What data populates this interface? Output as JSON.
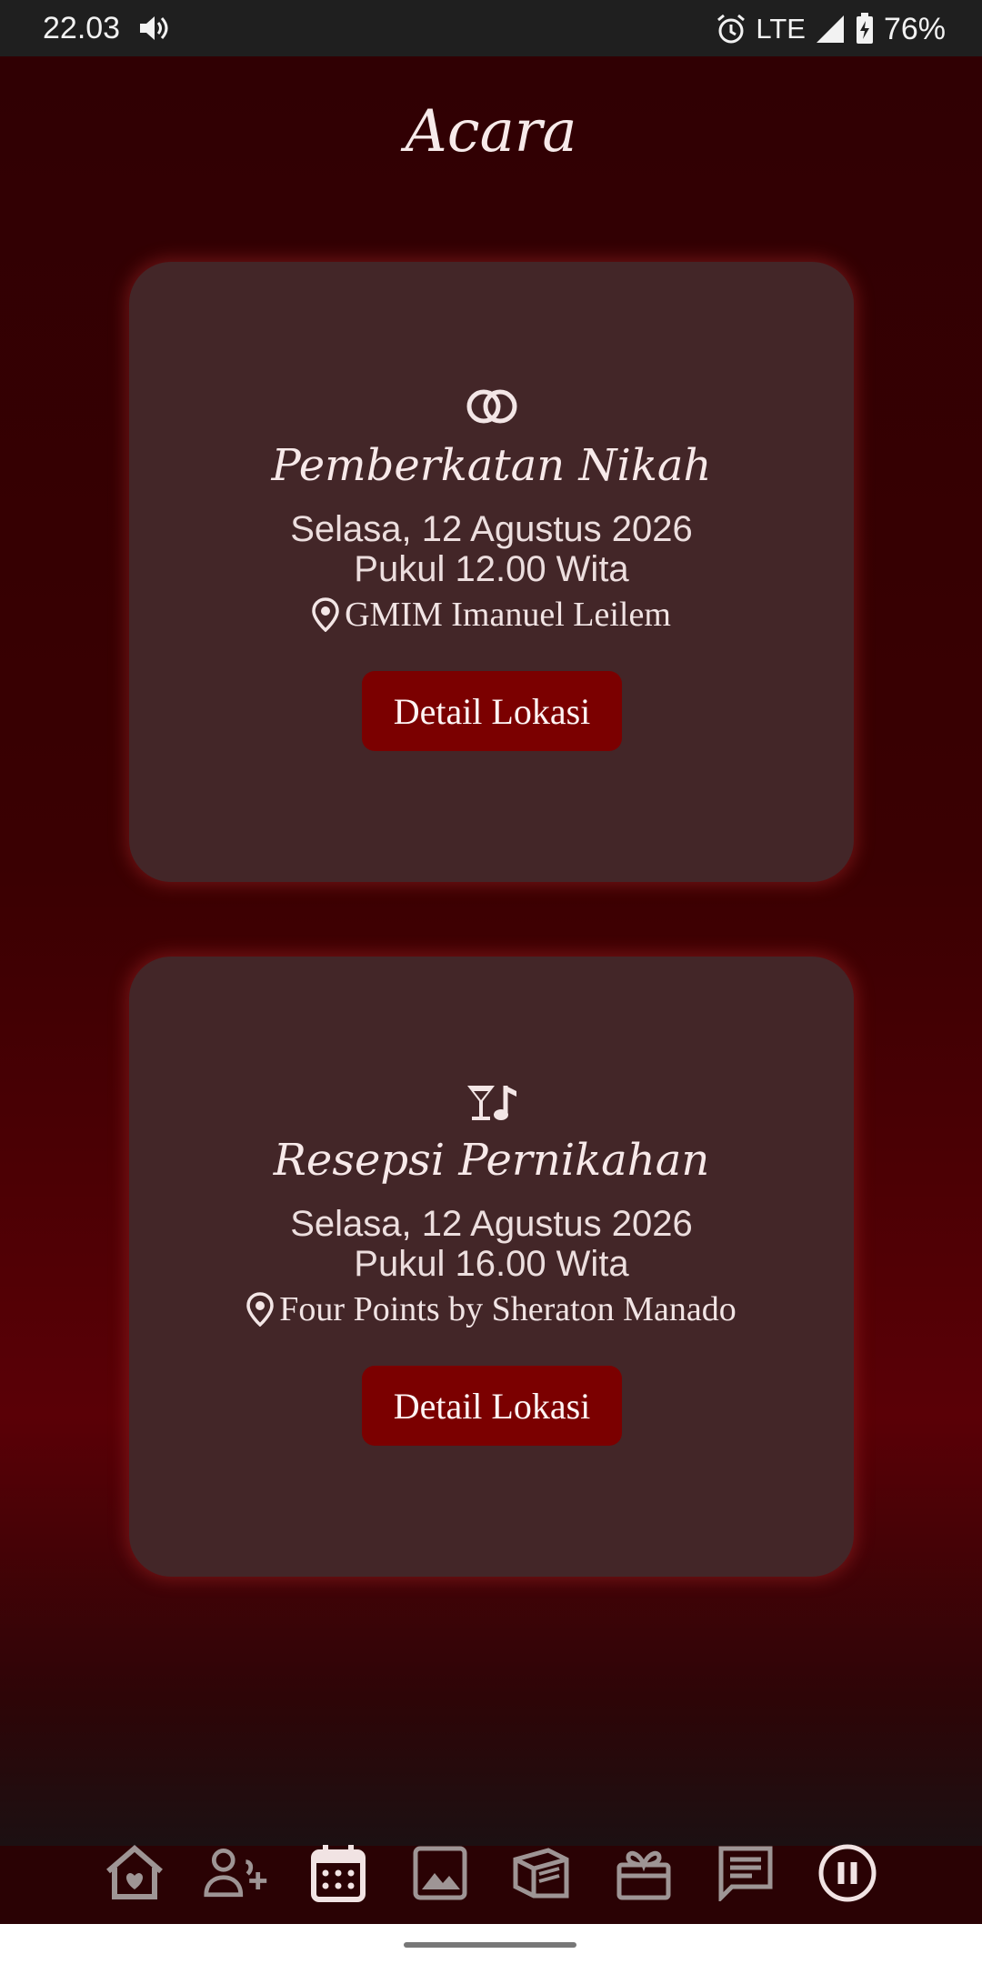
{
  "status_bar": {
    "time": "22.03",
    "network": "LTE",
    "battery": "76%"
  },
  "page": {
    "title": "Acara"
  },
  "events": [
    {
      "icon": "rings-icon",
      "title": "Pemberkatan Nikah",
      "date": "Selasa, 12 Agustus 2026",
      "time": "Pukul 12.00 Wita",
      "location": "GMIM Imanuel Leilem",
      "button_label": "Detail Lokasi"
    },
    {
      "icon": "cocktail-music-icon",
      "title": "Resepsi Pernikahan",
      "date": "Selasa, 12 Agustus 2026",
      "time": "Pukul 16.00 Wita",
      "location": "Four Points by Sheraton Manado",
      "button_label": "Detail Lokasi"
    }
  ],
  "bottom_nav": {
    "items": [
      "home-heart-icon",
      "add-person-icon",
      "calendar-icon",
      "image-icon",
      "book-icon",
      "gift-icon",
      "message-icon",
      "pause-icon"
    ],
    "active": "calendar-icon"
  },
  "colors": {
    "background_top": "#300003",
    "background_mid": "#5a0006",
    "card": "#432628",
    "button": "#7b0000",
    "text": "#f3e6e6"
  }
}
